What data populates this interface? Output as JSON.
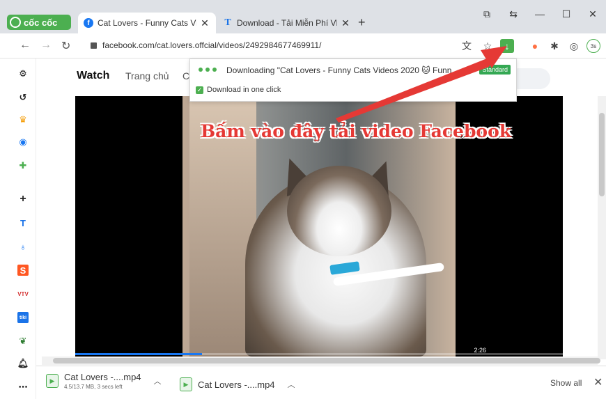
{
  "browser": {
    "brand": "cốc cốc",
    "tabs": [
      {
        "label": "Cat Lovers - Funny Cats Vide",
        "active": true
      },
      {
        "label": "Download - Tải Miễn Phí VN",
        "active": false
      }
    ],
    "new_tab": "+",
    "url": "facebook.com/cat.lovers.offcial/videos/2492984677469911/"
  },
  "facebook": {
    "nav_watch": "Watch",
    "nav_home": "Trang chủ",
    "nav_c": "C"
  },
  "download_popup": {
    "status": "Downloading \"Cat Lovers - Funny Cats Videos 2020 🐱 Funn",
    "quality": "Standard",
    "checkbox_label": "Download in one click",
    "checkbox_mark": "✓"
  },
  "annotation": "Bấm vào đây tải video Facebook",
  "video": {
    "time": "2:26",
    "progress": 0.26
  },
  "shelf": {
    "items": [
      {
        "name": "Cat Lovers -....mp4",
        "sub": "4.5/13.7 MB, 3 secs left"
      },
      {
        "name": "Cat Lovers -....mp4",
        "sub": ""
      }
    ],
    "show_all": "Show all",
    "close": "✕"
  },
  "colors": {
    "accent": "#4caf50",
    "annotation": "#e53935",
    "facebook": "#1877f2"
  }
}
